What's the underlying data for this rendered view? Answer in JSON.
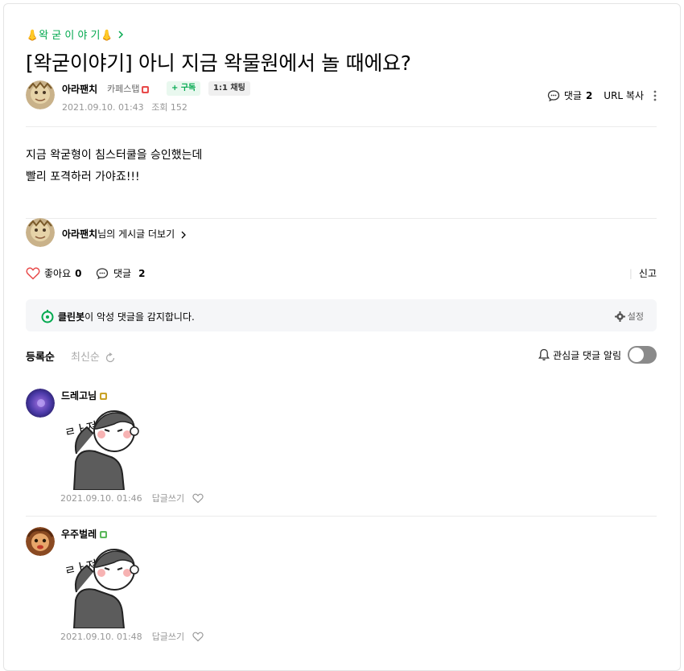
{
  "board": {
    "label": "👃왁 굳 이 야 기👃"
  },
  "article": {
    "title": "[왁굳이야기] 아니 지금 왁물원에서 놀 때에요?",
    "body_lines": [
      "지금 왁굳형이 침스터쿨을 승인했는데",
      "빨리 포격하러 가야죠!!!"
    ]
  },
  "author": {
    "nickname": "아라팬치",
    "grade": "카페스탭",
    "subscribe_label": "+ 구독",
    "chat_label": "1:1 채팅",
    "date": "2021.09.10. 01:43",
    "views_label": "조회 152"
  },
  "tools": {
    "comments_label": "댓글",
    "comments_count": "2",
    "url_copy": "URL 복사"
  },
  "more_posts": {
    "nickname": "아라팬치",
    "suffix": "님의 게시글 더보기"
  },
  "reactions": {
    "like_label": "좋아요",
    "like_count": "0",
    "comment_label": "댓글",
    "comment_count": "2",
    "report_label": "신고"
  },
  "cleanbot": {
    "name": "클린봇",
    "text": "이 악성 댓글을 감지합니다.",
    "setting": "설정"
  },
  "sort": {
    "registered": "등록순",
    "latest": "최신순"
  },
  "notify": {
    "label": "관심글 댓글 알림",
    "enabled": false
  },
  "colors": {
    "accent": "#03a94f",
    "staff_badge": "#e84b4b",
    "gold_badge": "#c9a227",
    "green_badge": "#5cb85c"
  },
  "comments": [
    {
      "nickname": "드레고님",
      "sticker_text": "ㄹㅏ져",
      "date": "2021.09.10. 01:46",
      "reply_label": "답글쓰기"
    },
    {
      "nickname": "우주벌레",
      "sticker_text": "ㄹㅏ져",
      "date": "2021.09.10. 01:48",
      "reply_label": "답글쓰기"
    }
  ]
}
